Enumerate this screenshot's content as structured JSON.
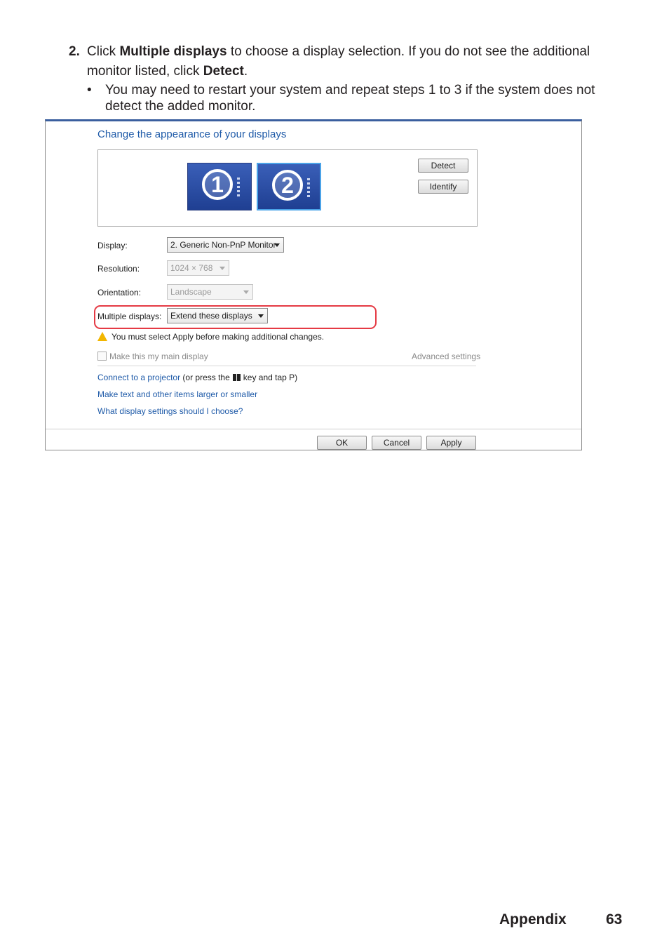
{
  "step": {
    "number": "2.",
    "t1": "Click ",
    "b1": "Multiple displays",
    "t2": " to choose a display selection. If you do not see the additional monitor listed, click ",
    "b2": "Detect",
    "t3": "."
  },
  "bullet": {
    "mark": "•",
    "text": "You may need to restart your system and repeat steps 1 to 3 if the system does not detect the added monitor."
  },
  "screenshot": {
    "title": "Change the appearance of your displays",
    "monitor_1": "1",
    "monitor_2": "2",
    "detect_button": "Detect",
    "identify_button": "Identify",
    "display_label": "Display:",
    "display_value": "2. Generic Non-PnP Monitor",
    "resolution_label": "Resolution:",
    "resolution_value": "1024 × 768",
    "orientation_label": "Orientation:",
    "orientation_value": "Landscape",
    "multiple_label": "Multiple displays:",
    "multiple_value": "Extend these displays",
    "warning": "You must select Apply before making additional changes.",
    "main_display_checkbox": "Make this my main display",
    "advanced_link": "Advanced settings",
    "projector_link": "Connect to a projector",
    "projector_note_1": "(or press the",
    "projector_note_2": "key and tap P)",
    "text_size_link": "Make text and other items larger or smaller",
    "help_link": "What display settings should I choose?",
    "ok_button": "OK",
    "cancel_button": "Cancel",
    "apply_button": "Apply",
    "colors": {
      "link": "#1e5aa8",
      "highlight": "#e53a44",
      "monitor": "#2f55a8"
    }
  },
  "footer": {
    "section": "Appendix",
    "page": "63"
  }
}
